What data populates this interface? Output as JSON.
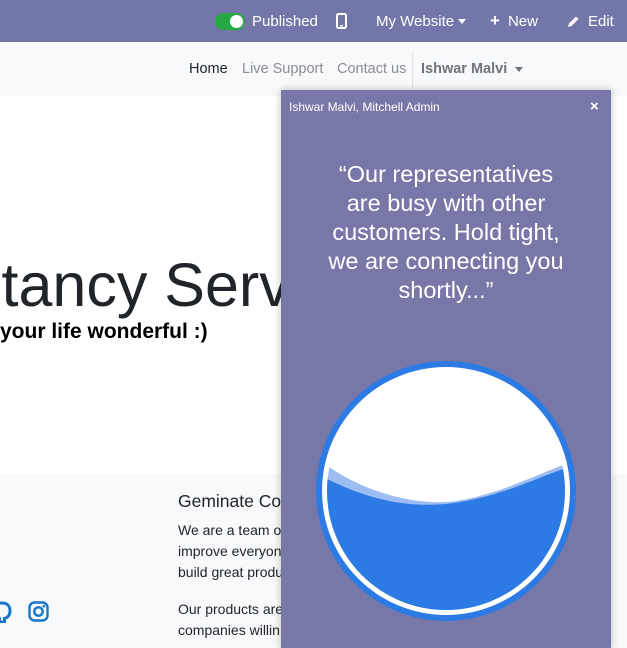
{
  "topbar": {
    "published_label": "Published",
    "website_label": "My Website",
    "new_label": "New",
    "edit_label": "Edit",
    "toggle_color": "#28a745",
    "bar_color": "#7376a8"
  },
  "navbar": {
    "items": [
      {
        "label": "Home"
      },
      {
        "label": "Live Support"
      },
      {
        "label": "Contact us"
      }
    ],
    "user_label": "Ishwar Malvi"
  },
  "hero": {
    "title": "ltancy Serv",
    "subtitle": "your life wonderful :)"
  },
  "footer": {
    "title": "Geminate Co",
    "lines": [
      "We are a team o",
      "improve everyon",
      "build great produ",
      "Our products are",
      "companies willin"
    ],
    "social_icons": [
      "github-icon",
      "instagram-icon"
    ]
  },
  "chat": {
    "participants": "Ishwar Malvi, Mitchell Admin",
    "close_label": "×",
    "message_lines": [
      "“Our representatives",
      "are busy with other",
      "customers. Hold tight,",
      "we are connecting you",
      "shortly...”"
    ],
    "loader_icon": "water-fill-loader-icon",
    "loader_color": "#2c7be5"
  }
}
